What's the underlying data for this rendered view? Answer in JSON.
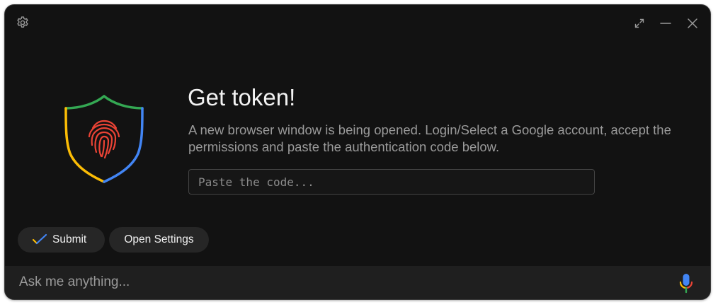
{
  "window": {
    "controls": {
      "settings_icon": "gear-icon",
      "expand_icon": "expand-icon",
      "minimize_icon": "minimize-icon",
      "close_icon": "close-icon"
    }
  },
  "main": {
    "icon": "shield-fingerprint-icon",
    "title": "Get token!",
    "description": "A new browser window is being opened. Login/Select a Google account, accept the permissions and paste the authentication code below.",
    "code_input": {
      "value": "",
      "placeholder": "Paste the code..."
    }
  },
  "actions": {
    "submit_label": "Submit",
    "open_settings_label": "Open Settings"
  },
  "bottom_bar": {
    "input_value": "",
    "input_placeholder": "Ask me anything...",
    "mic_icon": "microphone-icon"
  },
  "colors": {
    "background": "#121212",
    "surface": "#262626",
    "google_blue": "#4285F4",
    "google_red": "#EA4335",
    "google_yellow": "#FBBC05",
    "google_green": "#34A853"
  }
}
